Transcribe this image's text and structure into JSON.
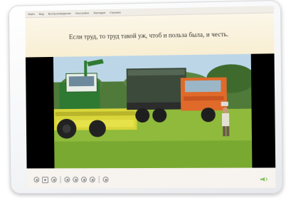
{
  "menu": {
    "items": [
      "Файл",
      "Вид",
      "Воспроизведение",
      "Настройки",
      "Закладки",
      "Справка"
    ]
  },
  "slide": {
    "title": "Если труд, то труд такой уж, чтоб и польза была, и честь."
  },
  "player": {
    "controls": [
      "skip-back-icon",
      "stop-icon",
      "record-icon",
      "rewind-icon",
      "play-icon",
      "pause-icon",
      "fast-forward-icon",
      "skip-forward-icon",
      "settings-icon"
    ]
  }
}
